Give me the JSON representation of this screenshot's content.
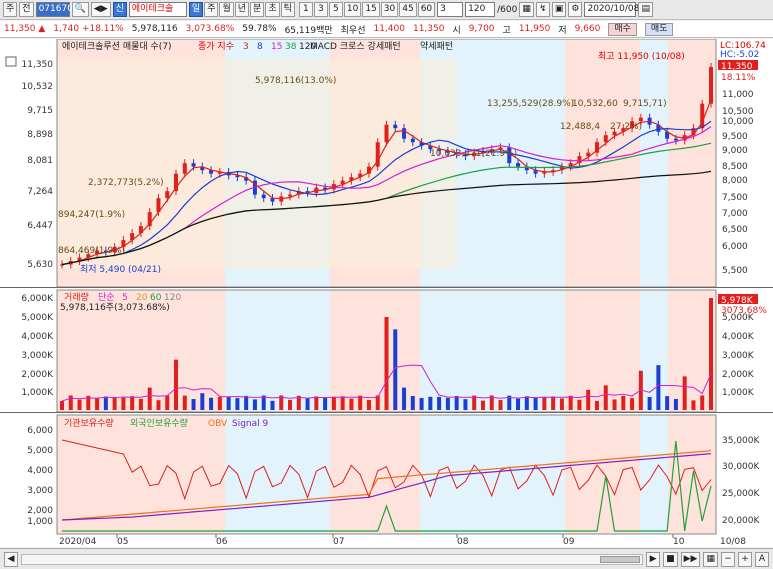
{
  "toolbar": {
    "btn_ju": "주",
    "btn_jeon": "전",
    "code": "071670",
    "sin": "신",
    "stock_name": "에이테크솔",
    "periods": [
      "일",
      "주",
      "월",
      "년",
      "분",
      "초",
      "틱"
    ],
    "active_period": "일",
    "minutes": [
      "1",
      "3",
      "5",
      "10",
      "15",
      "30",
      "45",
      "60"
    ],
    "min_sel": "3",
    "count": "120",
    "count_total": "/600",
    "date": "2020/10/08"
  },
  "info": {
    "price": "11,350",
    "change": "1,740",
    "pct": "+18.11%",
    "volume": "5,978,116",
    "vol_pct": "3,073.68%",
    "turnover": "59.78%",
    "amount": "65,119백만",
    "pref": "최우선",
    "pref_ask": "11,400",
    "pref_bid": "11,350",
    "open_label": "시",
    "open": "9,700",
    "high_label": "고",
    "high": "11,950",
    "low_label": "저",
    "low": "9,660",
    "buy": "매수",
    "sell": "매도"
  },
  "price_panel": {
    "title": "에이테크솔루션 매물대 수(7)",
    "ma_label": "종가 지수",
    "ma_periods": [
      "3",
      "8",
      "15",
      "38",
      "120"
    ],
    "macd": "MACD 크로스 강세패턴",
    "weak": "약세패턴",
    "yticks": [
      "11,350",
      "10,532",
      "9,715",
      "8,898",
      "8,081",
      "7,264",
      "6,447",
      "5,630"
    ],
    "ryticks": [
      "11,000",
      "10,500",
      "10,000",
      "9,500",
      "9,000",
      "8,500",
      "8,000",
      "7,500",
      "7,000",
      "6,500",
      "6,000",
      "5,500"
    ],
    "lc": "LC:106.74",
    "hc": "HC:-5.02",
    "price_tag": "11,350",
    "pct_tag": "18.11%",
    "high_note": "최고 11,950 (10/08)",
    "low_note": "최저 5,490 (04/21)",
    "labels": [
      "5,978,116(13.0%)",
      "2,372,773(5.2%)",
      "894,247(1.9%)",
      "864,469(1.9%)",
      "13,255,529(28.9%)",
      "10,532,60",
      "9,715,71)",
      "12,488,4",
      "27.2%)",
      "10,033,471(21.9%)"
    ]
  },
  "volume_panel": {
    "title": "거래량",
    "title2": "단순",
    "periods": [
      "5",
      "20",
      "60",
      "120"
    ],
    "sub": "5,978,116주(3,073.68%)",
    "yticks": [
      "6,000K",
      "5,000K",
      "4,000K",
      "3,000K",
      "2,000K",
      "1,000K"
    ],
    "ryticks": [
      "5,000K",
      "4,000K",
      "3,000K",
      "2,000K",
      "1,000K"
    ],
    "tag1": "5,978K",
    "tag2": "3073.68%"
  },
  "flow_panel": {
    "l1": "기관보유수량",
    "l2": "외국인보유수량",
    "l3": "OBV",
    "l4": "Signal 9",
    "yticks": [
      "6,000",
      "5,000",
      "4,000",
      "3,000",
      "2,000",
      "1,000"
    ],
    "ryticks": [
      "35,000K",
      "30,000K",
      "25,000K",
      "20,000K"
    ]
  },
  "xaxis": {
    "labels": [
      "2020/04",
      "05",
      "06",
      "07",
      "08",
      "09",
      "10",
      "10/08"
    ]
  },
  "colors": {
    "up": "#e0201c",
    "down": "#1a3fd0",
    "bg_pink": "#fde3dc",
    "bg_blue": "#e2f3fb",
    "bg_beige": "#fbefdc"
  }
}
